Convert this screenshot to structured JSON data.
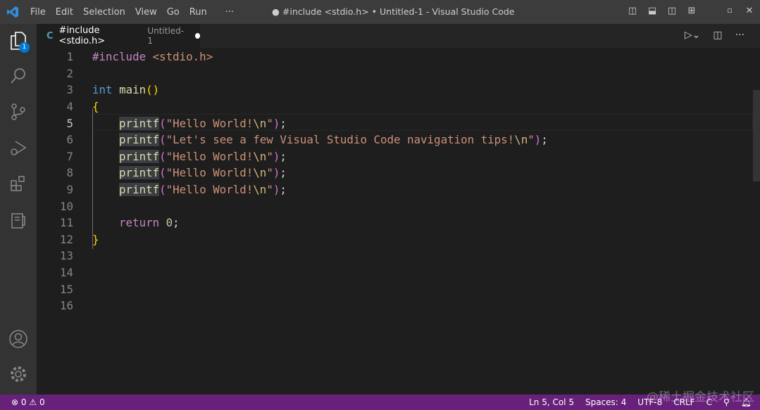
{
  "titlebar": {
    "menu": [
      "File",
      "Edit",
      "Selection",
      "View",
      "Go",
      "Run",
      "···"
    ],
    "title": "● #include <stdio.h> • Untitled-1 - Visual Studio Code"
  },
  "activity": {
    "explorer_badge": "1"
  },
  "tab": {
    "icon_label": "C",
    "name": "#include <stdio.h>",
    "description": "Untitled-1"
  },
  "editor": {
    "line_numbers": [
      "1",
      "2",
      "3",
      "4",
      "5",
      "6",
      "7",
      "8",
      "9",
      "10",
      "11",
      "12",
      "13",
      "14",
      "15",
      "16"
    ],
    "current_line": 5,
    "code": {
      "l1a": "#include",
      "l1b": " <stdio.h>",
      "l3a": "int",
      "l3b": "main",
      "l3c": "()",
      "l4": "{",
      "pf": "printf",
      "op": "(",
      "cp": ")",
      "semi": ";",
      "s5": "\"Hello World!",
      "esc": "\\n",
      "q": "\"",
      "s6": "\"Let's see a few Visual Studio Code navigation tips!",
      "ret": "return",
      "zero": "0",
      "l12": "}"
    }
  },
  "status": {
    "errors": "0",
    "warnings": "0",
    "position": "Ln 5, Col 5",
    "spaces": "Spaces: 4",
    "encoding": "UTF-8",
    "eol": "CRLF",
    "language": "C"
  },
  "colors": {
    "statusbar": "#68217a",
    "accent": "#0078d4"
  },
  "watermark": "@稀土掘金技术社区"
}
